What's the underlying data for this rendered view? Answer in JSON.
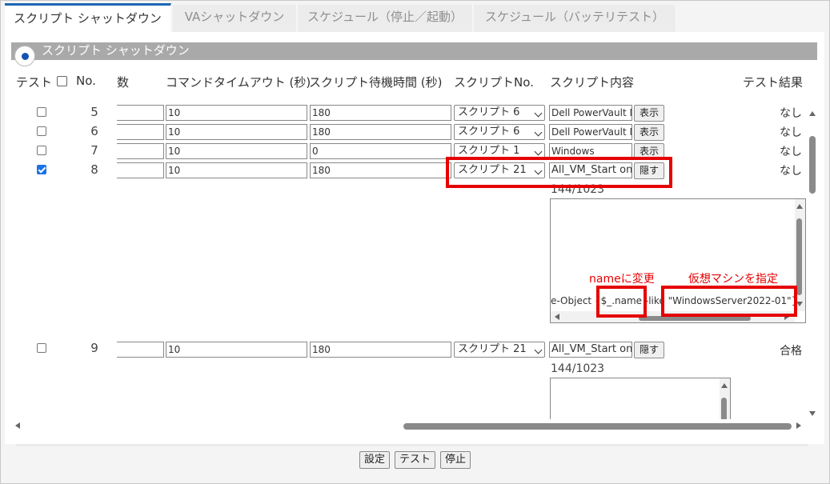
{
  "tabs": [
    {
      "label": "スクリプト シャットダウン"
    },
    {
      "label": "VAシャットダウン"
    },
    {
      "label": "スケジュール（停止／起動）"
    },
    {
      "label": "スケジュール（バッテリテスト）"
    }
  ],
  "section_title": "スクリプト シャットダウン",
  "headers": {
    "test": "テスト",
    "no": "No.",
    "count": "数",
    "timeout": "コマンドタイムアウト (秒)",
    "wait": "スクリプト待機時間 (秒)",
    "script_no": "スクリプトNo.",
    "script_content": "スクリプト内容",
    "result": "テスト結果"
  },
  "rows": [
    {
      "checked": false,
      "no": "5",
      "count": "",
      "timeout": "10",
      "wait": "180",
      "script": "スクリプト 6",
      "content": "Dell PowerVault M",
      "button": "表示",
      "result": "なし"
    },
    {
      "checked": false,
      "no": "6",
      "count": "",
      "timeout": "10",
      "wait": "180",
      "script": "スクリプト 6",
      "content": "Dell PowerVault M",
      "button": "表示",
      "result": "なし"
    },
    {
      "checked": false,
      "no": "7",
      "count": "",
      "timeout": "10",
      "wait": "0",
      "script": "スクリプト 1",
      "content": "Windows",
      "button": "表示",
      "result": "なし"
    },
    {
      "checked": true,
      "no": "8",
      "count": "",
      "timeout": "10",
      "wait": "180",
      "script": "スクリプト 21",
      "content": "All_VM_Start on",
      "button": "隠す",
      "result": "なし",
      "char_count": "144/1023",
      "script_line": {
        "a": "e-Object {$_.name",
        "b": " -like ",
        "c": "\"WindowsServer2022-01\"}"
      }
    },
    {
      "checked": false,
      "no": "9",
      "count": "",
      "timeout": "10",
      "wait": "180",
      "script": "スクリプト 21",
      "content": "All_VM_Start on",
      "button": "隠す",
      "result": "合格",
      "char_count": "144/1023"
    }
  ],
  "annotations": {
    "name_change": "nameに変更",
    "vm_specify": "仮想マシンを指定"
  },
  "colors": {
    "accent": "#1e66b5",
    "annotation": "#e60000",
    "section_bar": "#a9a9a9"
  },
  "buttons": {
    "set": "設定",
    "test": "テスト",
    "stop": "停止"
  }
}
